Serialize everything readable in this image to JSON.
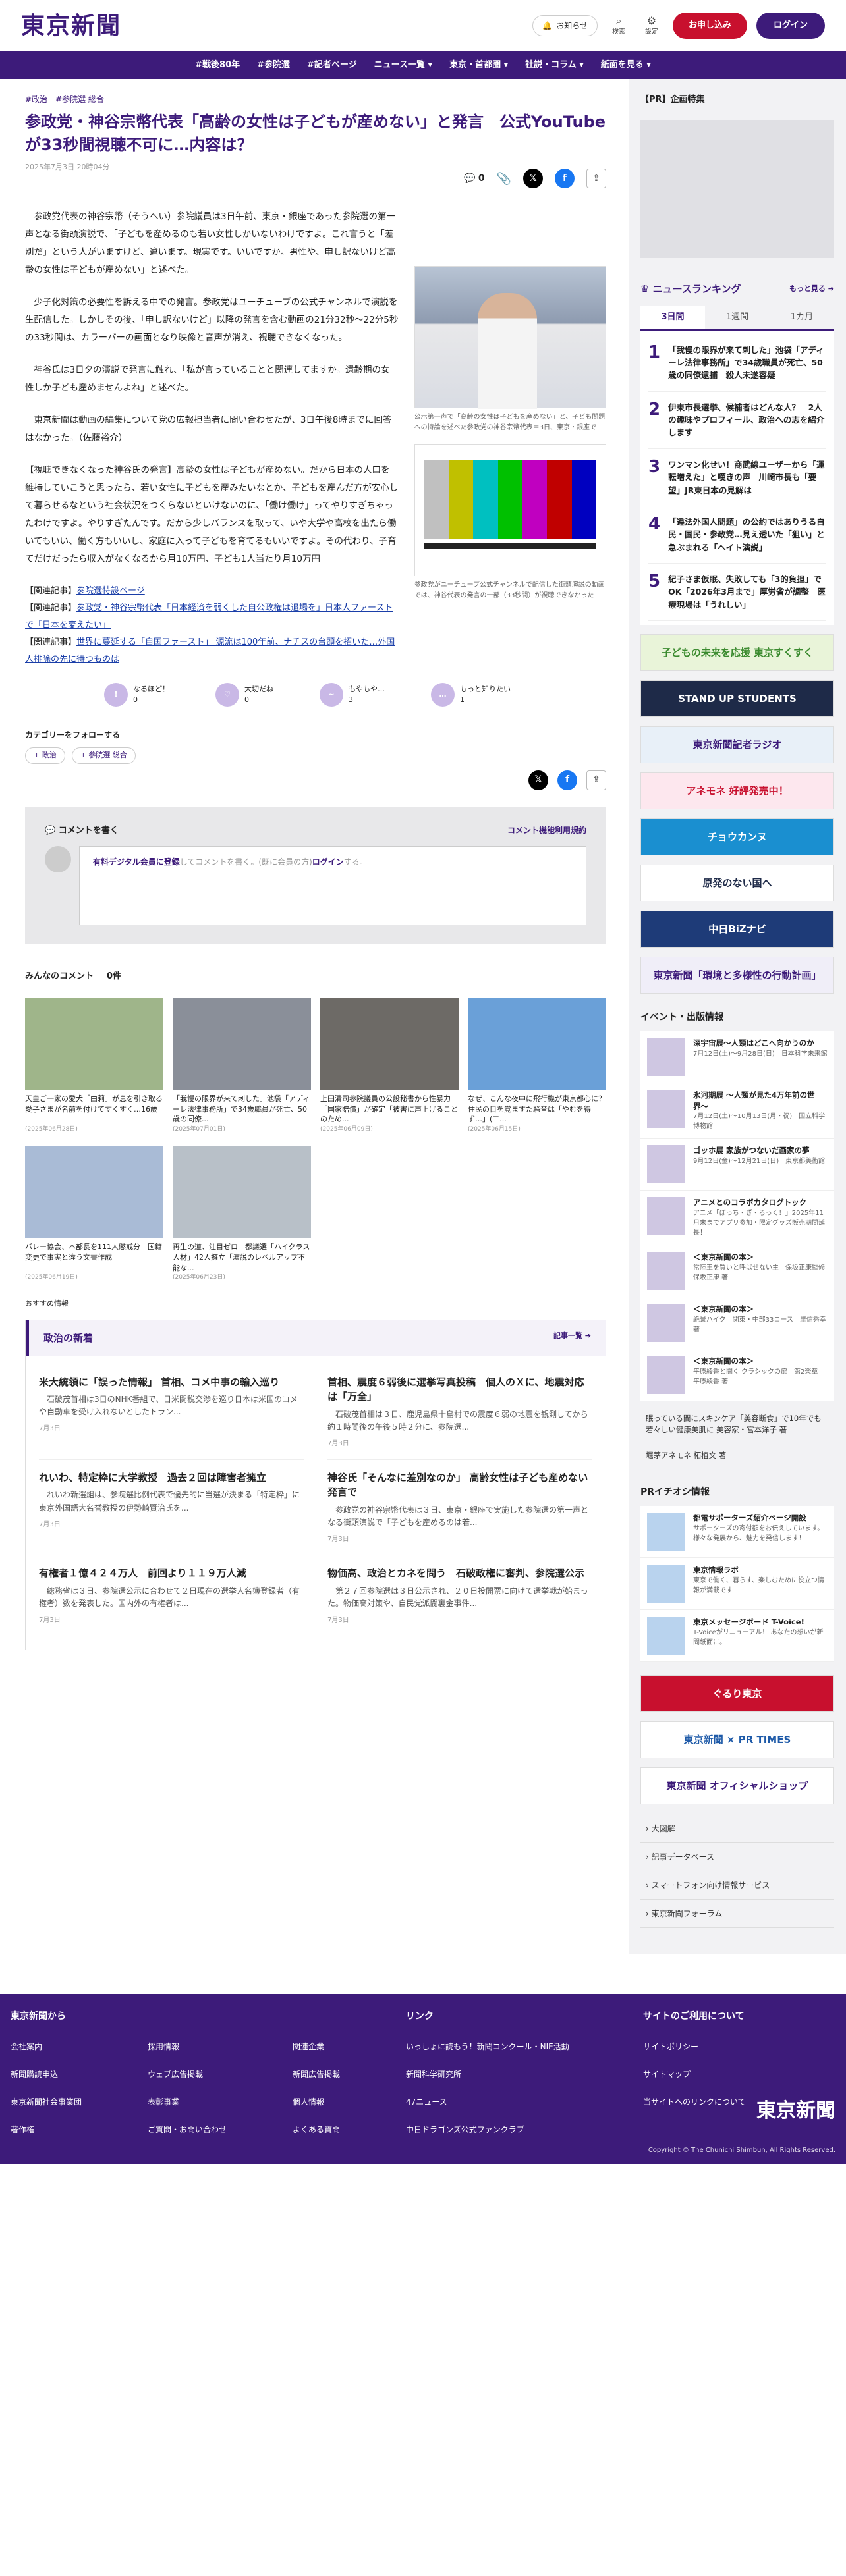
{
  "header": {
    "logo": "東京新聞",
    "notify": "お知らせ",
    "search": "検索",
    "settings": "設定",
    "apply": "お申し込み",
    "login": "ログイン"
  },
  "nav": [
    "#戦後80年",
    "#参院選",
    "#記者ページ",
    "ニュース一覧 ▾",
    "東京・首都圏 ▾",
    "社説・コラム ▾",
    "紙面を見る ▾"
  ],
  "article": {
    "tags": [
      "#政治",
      "#参院選 総合"
    ],
    "title": "参政党・神谷宗幣代表「高齢の女性は子どもが産めない」と発言　公式YouTubeが33秒間視聴不可に…内容は？",
    "date": "2025年7月3日 20時04分",
    "comment_count": "0",
    "paragraphs": [
      "　参政党代表の神谷宗幣（そうへい）参院議員は3日午前、東京・銀座であった参院選の第一声となる街頭演説で、「子どもを産めるのも若い女性しかいないわけですよ。これ言うと「差別だ」という人がいますけど、違います。現実です。いいですか。男性や、申し訳ないけど高齢の女性は子どもが産めない」と述べた。",
      "　少子化対策の必要性を訴える中での発言。参政党はユーチューブの公式チャンネルで演説を生配信した。しかしその後、「申し訳ないけど」以降の発言を含む動画の21分32秒〜22分5秒の33秒間は、カラーバーの画面となり映像と音声が消え、視聴できなくなった。",
      "　神谷氏は3日夕の演説で発言に触れ、「私が言っていることと関連してますか。遺齢期の女性しか子ども産めませんよね」と述べた。",
      "　東京新聞は動画の編集について党の広報担当者に問い合わせたが、3日午後8時までに回答はなかった。（佐藤裕介）",
      "【視聴できなくなった神谷氏の発言】高齢の女性は子どもが産めない。だから日本の人口を維持していこうと思ったら、若い女性に子どもを産みたいなとか、子どもを産んだ方が安心して暮らせるなという社会状況をつくらないといけないのに、「働け働け」ってやりすぎちゃったわけですよ。やりすぎたんです。だから少しバランスを取って、いや大学や高校を出たら働いてもいい、働く方もいいし、家庭に入って子どもを育てるもいいですよ。その代わり、子育てだけだったら収入がなくなるから月10万円、子ども1人当たり月10万円"
    ],
    "related": [
      {
        "label": "【関連記事】",
        "link": "参院選特設ページ"
      },
      {
        "label": "【関連記事】",
        "link": "参政党・神谷宗幣代表「日本経済を弱くした自公政権は退場を」日本人ファーストで「日本を変えたい」"
      },
      {
        "label": "【関連記事】",
        "link": "世界に蔓延する「自国ファースト」 源流は100年前、ナチスの台頭を招いた…外国人排除の先に待つものは"
      }
    ],
    "captions": [
      "公示第一声で「高齢の女性は子どもを産めない」と、子ども問題への持論を述べた参政党の神谷宗幣代表＝3日、東京・銀座で",
      "参政党がユーチューブ公式チャンネルで配信した街頭演説の動画では、神谷代表の発言の一部（33秒間）が視聴できなかった"
    ],
    "reactions": [
      {
        "label": "なるほど！",
        "count": "0"
      },
      {
        "label": "大切だね",
        "count": "0"
      },
      {
        "label": "もやもや…",
        "count": "3"
      },
      {
        "label": "もっと知りたい",
        "count": "1"
      }
    ],
    "follow_label": "カテゴリーをフォローする",
    "follow_chips": [
      "+ 政治",
      "+ 参院選 総合"
    ]
  },
  "comments": {
    "write": "コメントを書く",
    "policy": "コメント機能利用規約",
    "prompt_link": "有料デジタル会員に登録",
    "prompt_mid": "してコメントを書く。(既に会員の方)",
    "prompt_login": "ログイン",
    "prompt_end": "する。",
    "all": "みんなのコメント",
    "all_count": "0件"
  },
  "grid_articles": [
    {
      "title": "天皇ご一家の愛犬「由莉」が息を引き取る　愛子さまが名前を付けてすくすく…16歳",
      "date": "(2025年06月28日)"
    },
    {
      "title": "「我慢の限界が来て刺した」池袋「アディーレ法律事務所」で34歳職員が死亡、50歳の同僚...",
      "date": "(2025年07月01日)"
    },
    {
      "title": "上田清司参院議員の公設秘書から性暴力「国家賠償」が確定「被害に声上げることのため...",
      "date": "(2025年06月09日)"
    },
    {
      "title": "なぜ、こんな夜中に飛行機が東京都心に？住民の目を覚ますた騒音は「やむを得ず…」(二...",
      "date": "(2025年06月15日)"
    },
    {
      "title": "バレー協会、本部長を111人懲戒分　国籍変更で事実と違う文書作成",
      "date": "(2025年06月19日)"
    },
    {
      "title": "再生の道、注目ゼロ　都議選「ハイクラス人材」42人擁立「演説のレベルアップ不能な...",
      "date": "(2025年06月23日)"
    }
  ],
  "osusume": "おすすめ情報",
  "politics": {
    "title": "政治の新着",
    "more": "記事一覧 ➔",
    "items": [
      {
        "h": "米大統領に「誤った情報」 首相、コメ中事の輸入巡り",
        "s": "　石破茂首相は3日のNHK番組で、日米関税交渉を巡り日本は米国のコメや自動車を受け入れないとしたトラン...",
        "d": "7月3日"
      },
      {
        "h": "首相、震度６弱後に選挙写真投稿　個人のＸに、地震対応は「万全」",
        "s": "　石破茂首相は３日、鹿児島県十島村での震度６弱の地震を観測してから約１時間後の午後５時２分に、参院選...",
        "d": "7月3日"
      },
      {
        "h": "れいわ、特定枠に大学教授　過去２回は障害者擁立",
        "s": "　れいわ新選組は、参院選比例代表で優先的に当選が決まる「特定枠」に東京外国語大名誉教授の伊勢崎賢治氏を...",
        "d": "7月3日"
      },
      {
        "h": "神谷氏「そんなに差別なのか」 高齢女性は子ども産めない発言で",
        "s": "　参政党の神谷宗幣代表は３日、東京・銀座で実施した参院選の第一声となる街頭演説で「子どもを産めるのは若...",
        "d": "7月3日"
      },
      {
        "h": "有権者１億４２４万人　前回より１１９万人減",
        "s": "　総務省は３日、参院選公示に合わせて２日現在の選挙人名簿登録者（有権者）数を発表した。国内外の有権者は...",
        "d": "7月3日"
      },
      {
        "h": "物価高、政治とカネを問う　石破政権に審判、参院選公示",
        "s": "　第２７回参院選は３日公示され、２０日投開票に向けて選挙戦が始まった。物価高対策や、自民党派閥裏金事件...",
        "d": "7月3日"
      }
    ]
  },
  "side": {
    "pr": "【PR】企画特集",
    "ranking_title": "ニュースランキング",
    "ranking_more": "もっと見る ➔",
    "tabs": [
      "3日間",
      "1週間",
      "1カ月"
    ],
    "ranking": [
      "「我慢の限界が来て刺した」池袋「アディーレ法律事務所」で34歳職員が死亡、50歳の同僚逮捕　殺人未遂容疑",
      "伊東市長選挙、候補者はどんな人？　2人の趣味やプロフィール、政治への志を紹介します",
      "ワンマン化せい！商武線ユーザーから「運転増えた」と嘆きの声　川崎市長も「要望」JR東日本の見解は",
      "「違法外国人問題」の公約ではありうる自民・国民・参政党…見え透いた「狙い」と急ぶまれる「ヘイト演説」",
      "紀子さま仮眠、失敗しても「3的負担」でOK「2026年3月まで」厚労省が調整　医療現場は「うれしい」"
    ],
    "banners": [
      {
        "t": "子どもの未来を応援 東京すくすく",
        "bg": "#e9f4d9",
        "c": "#3a8a2e"
      },
      {
        "t": "STAND UP STUDENTS",
        "bg": "#1e2a48",
        "c": "#fff"
      },
      {
        "t": "東京新聞記者ラジオ",
        "bg": "#e8f0f8",
        "c": "#3d1b7a"
      },
      {
        "t": "アネモネ 好評発売中！",
        "bg": "#fde7ee",
        "c": "#c8102e"
      },
      {
        "t": "チョウカンヌ",
        "bg": "#1a8fd0",
        "c": "#fff"
      },
      {
        "t": "原発のない国へ",
        "bg": "#fff",
        "c": "#1e2a48"
      },
      {
        "t": "中日BiZナビ",
        "bg": "#1e3b78",
        "c": "#fff"
      },
      {
        "t": "東京新聞「環境と多様性の行動計画」",
        "bg": "#f0eef8",
        "c": "#3d1b7a"
      }
    ],
    "events_title": "イベント・出版情報",
    "events": [
      {
        "t": "深宇宙展〜人類はどこへ向かうのか",
        "s": "7月12日(土)〜9月28日(日)　日本科学未来館"
      },
      {
        "t": "氷河期展 〜人類が見た4万年前の世界〜",
        "s": "7月12日(土)〜10月13日(月・祝)　国立科学博物館"
      },
      {
        "t": "ゴッホ展 家族がつないだ画家の夢",
        "s": "9月12日(金)〜12月21日(日)　東京都美術館"
      },
      {
        "t": "アニメとのコラボカタログトック",
        "s": "アニメ「ぼっち・ざ・ろっく！」2025年11月末までアプリ参加・限定グッズ販売期間延長！"
      },
      {
        "t": "＜東京新聞の本＞",
        "s": "常陸王を買いと呼ばせない主　保坂正康監修　保坂正康 著"
      },
      {
        "t": "＜東京新聞の本＞",
        "s": "絶景ハイク　関東・中部33コース　里信秀幸 著"
      },
      {
        "t": "＜東京新聞の本＞",
        "s": "平原綾香と開く クラシックの扉　第2楽章　平原綾香 著"
      }
    ],
    "links1": [
      "眠っている間にスキンケア「美容断食」で10年でも若々しい健康美肌に 美容家・宮本洋子 著",
      "堀茅アネモネ 柘植文 著"
    ],
    "prtimes_title": "PRイチオシ情報",
    "pr_items": [
      {
        "t": "都電サポーターズ紹介ページ開設",
        "s": "サポーターズの寄付額をお伝えしています。様々な発展から、魅力を発信します！"
      },
      {
        "t": "東京情報ラボ",
        "s": "東京で働く、暮らす、楽しむために役立つ情報が満載です"
      },
      {
        "t": "東京メッセージボード T-Voice!",
        "s": "T-Voiceがリニューアル！ あなたの想いが新聞紙面に。"
      }
    ],
    "banners2": [
      {
        "t": "ぐるり東京",
        "bg": "#c8102e",
        "c": "#fff"
      },
      {
        "t": "東京新聞 × PR TIMES",
        "bg": "#fff",
        "c": "#1e5aa8"
      },
      {
        "t": "東京新聞 オフィシャルショップ",
        "bg": "#fff",
        "c": "#3d1b7a"
      }
    ],
    "links2": [
      "大図解",
      "記事データベース",
      "スマートフォン向け情報サービス",
      "東京新聞フォーラム"
    ]
  },
  "footer": {
    "col1_title": "東京新聞から",
    "col1": [
      "会社案内",
      "採用情報",
      "関連企業",
      "新聞購読申込",
      "ウェブ広告掲載",
      "新聞広告掲載",
      "東京新聞社会事業団",
      "表彰事業",
      "個人情報",
      "著作権",
      "ご質問・お問い合わせ",
      "よくある質問"
    ],
    "col2_title": "リンク",
    "col2": [
      "いっしょに読もう！新聞コンクール・NIE活動",
      "新聞科学研究所",
      "47ニュース",
      "中日ドラゴンズ公式ファンクラブ"
    ],
    "col3_title": "サイトのご利用について",
    "col3": [
      "サイトポリシー",
      "サイトマップ",
      "当サイトへのリンクについて"
    ],
    "logo": "東京新聞",
    "copyright": "Copyright © The Chunichi Shimbun, All Rights Reserved."
  }
}
